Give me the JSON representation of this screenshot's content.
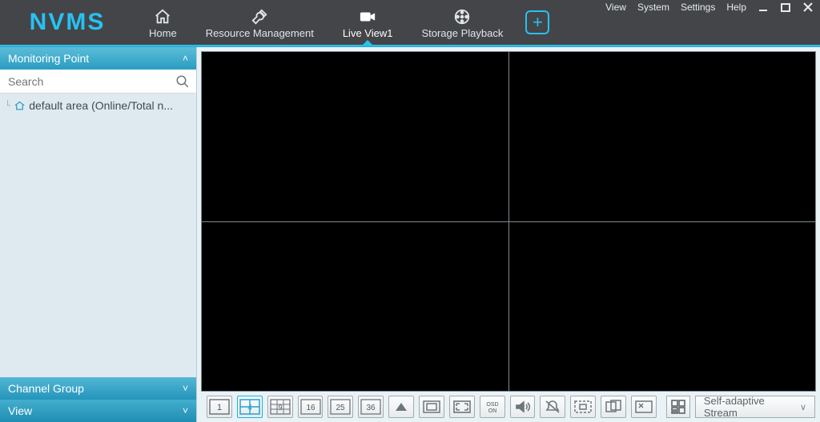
{
  "logo": "NVMS",
  "nav": {
    "home": "Home",
    "resource": "Resource Management",
    "live": "Live View1",
    "storage": "Storage Playback"
  },
  "sysmenu": {
    "view": "View",
    "system": "System",
    "settings": "Settings",
    "help": "Help"
  },
  "sidebar": {
    "monitoring_label": "Monitoring Point",
    "search_placeholder": "Search",
    "tree_item": "default area (Online/Total n...",
    "channel_group_label": "Channel Group",
    "view_label": "View"
  },
  "bottombar": {
    "layouts": [
      "1",
      "4",
      "9",
      "16",
      "25",
      "36"
    ],
    "stream_label": "Self-adaptive Stream",
    "active_layout": "4"
  }
}
